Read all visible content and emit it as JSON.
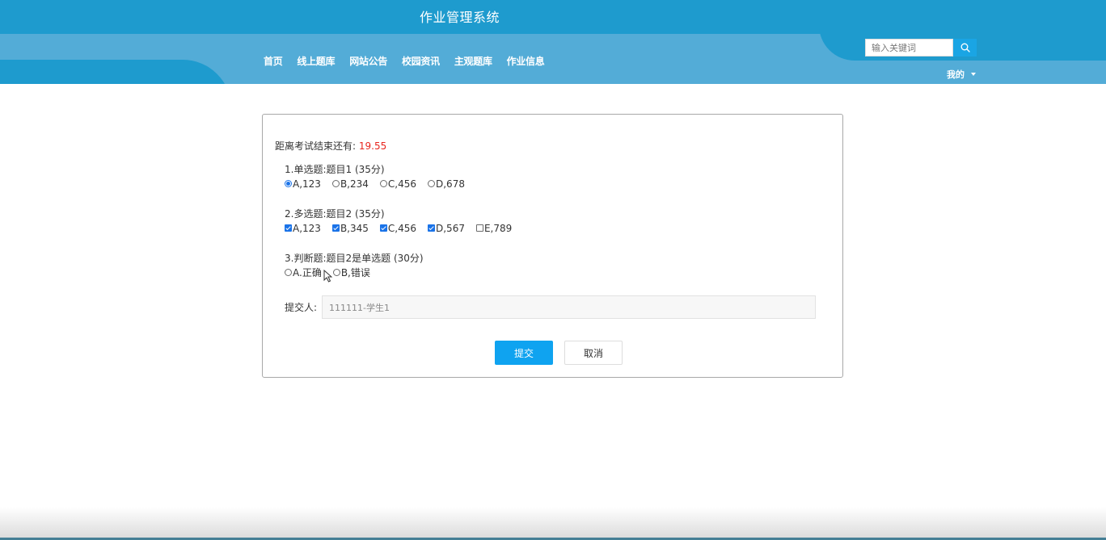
{
  "header": {
    "title": "作业管理系统",
    "nav": [
      "首页",
      "线上题库",
      "网站公告",
      "校园资讯",
      "主观题库",
      "作业信息"
    ],
    "search": {
      "placeholder": "输入关键词",
      "icon": "search-icon"
    },
    "user_menu": {
      "label": "我的",
      "icon": "caret-down-icon"
    },
    "colors": {
      "topbar": "#1e9bce",
      "navbar": "#53acd7"
    }
  },
  "exam": {
    "timer_label": "距离考试结束还有:",
    "timer_value": "19.55",
    "questions": [
      {
        "title": "1.单选题:题目1 (35分)",
        "type": "radio",
        "options": [
          {
            "label": "A,123",
            "checked": true
          },
          {
            "label": "B,234",
            "checked": false
          },
          {
            "label": "C,456",
            "checked": false
          },
          {
            "label": "D,678",
            "checked": false
          }
        ]
      },
      {
        "title": "2.多选题:题目2 (35分)",
        "type": "checkbox",
        "options": [
          {
            "label": "A,123",
            "checked": true
          },
          {
            "label": "B,345",
            "checked": true
          },
          {
            "label": "C,456",
            "checked": true
          },
          {
            "label": "D,567",
            "checked": true
          },
          {
            "label": "E,789",
            "checked": false
          }
        ]
      },
      {
        "title": "3.判断题:题目2是单选题 (30分)",
        "type": "radio",
        "options": [
          {
            "label": "A.正确",
            "checked": false
          },
          {
            "label": "B,错误",
            "checked": false
          }
        ]
      }
    ],
    "submitter_label": "提交人:",
    "submitter_value": "111111-学生1",
    "submit_label": "提交",
    "cancel_label": "取消",
    "colors": {
      "timer": "#e8251e",
      "submit": "#0fa3f0"
    }
  }
}
